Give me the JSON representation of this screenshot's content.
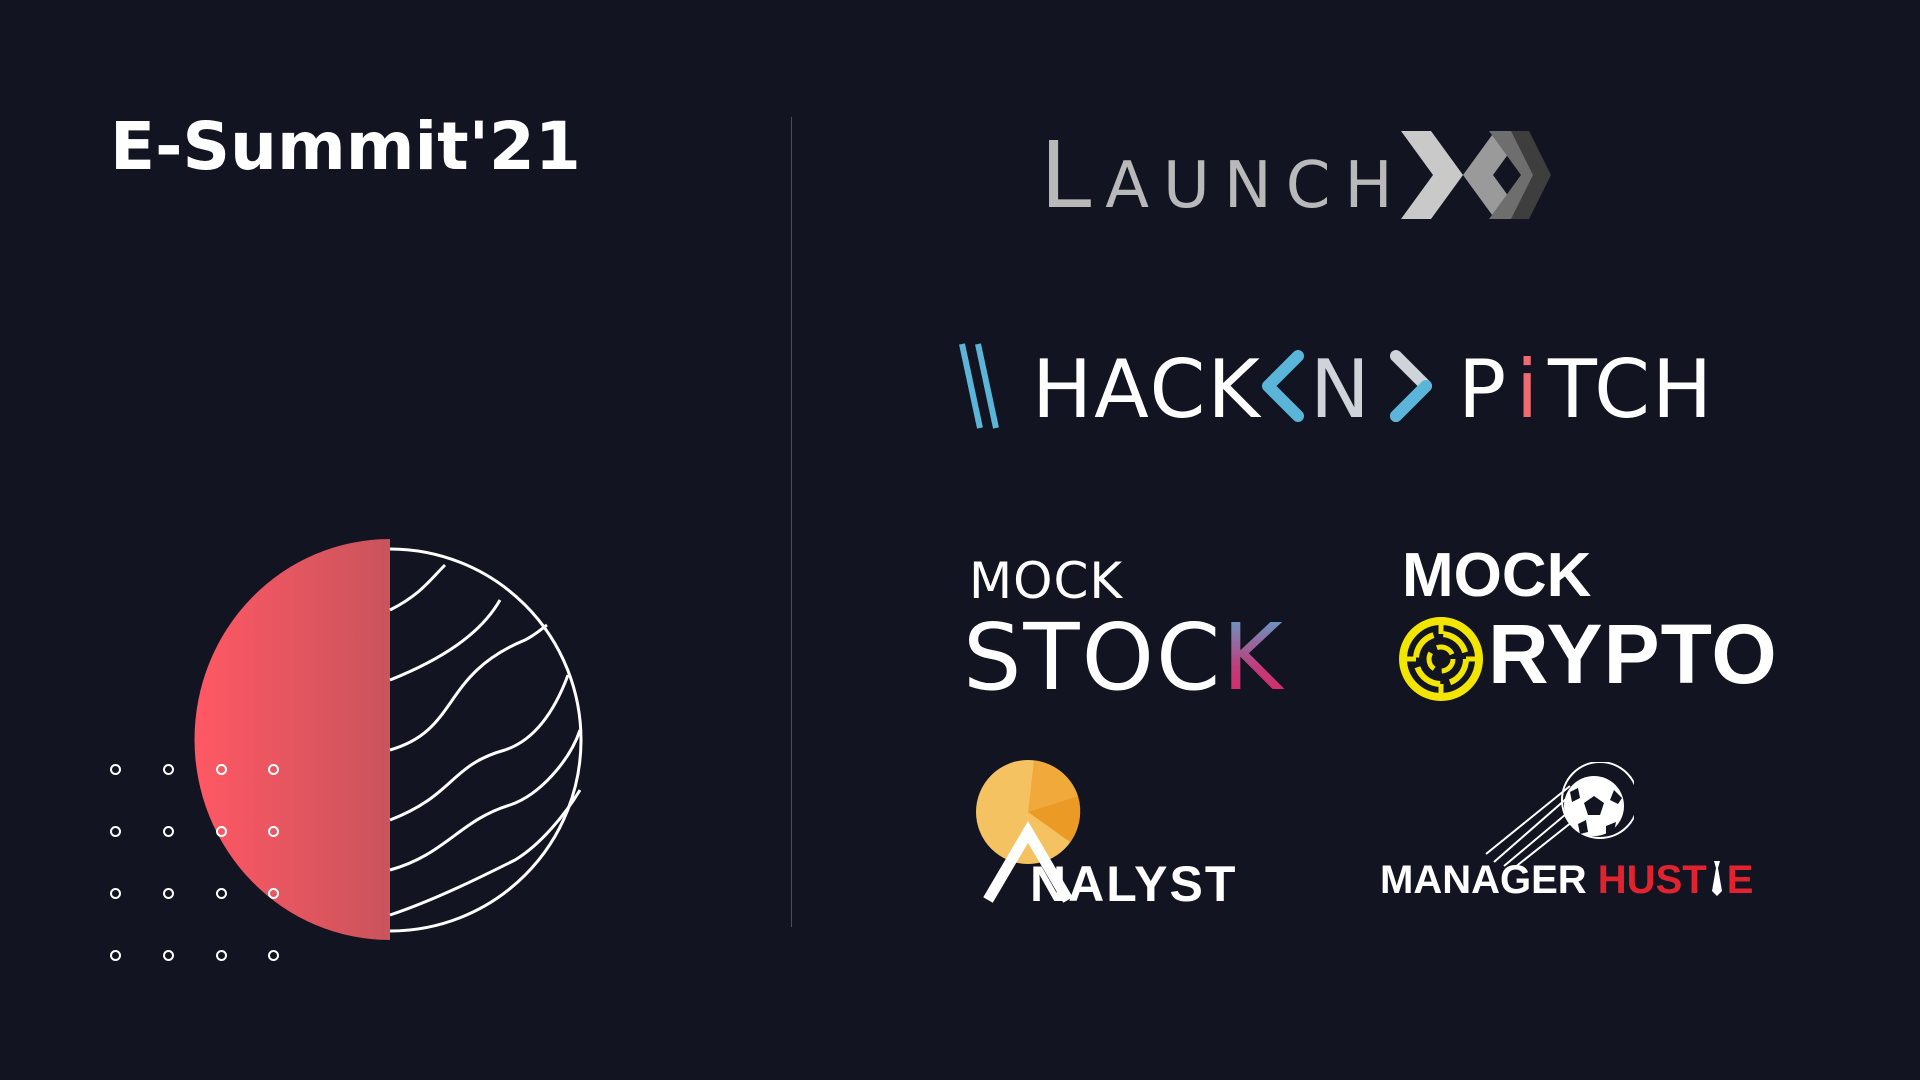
{
  "title": "E-Summit'21",
  "logos": {
    "launchx": {
      "text_main": "Launch",
      "text_x": "X"
    },
    "hacknpitch": {
      "word1": "HACK",
      "word2": "N",
      "word3_p": "P",
      "word3_i": "i",
      "word3_rest": "TCH"
    },
    "mockstock": {
      "line1": "MOCK",
      "line2_main": "STOC",
      "line2_accent": "K"
    },
    "mockcrypto": {
      "line1": "MOCK",
      "line2": "RYPTO"
    },
    "analyst": {
      "text": "NALYST"
    },
    "managerhustle": {
      "word1": "MANAGER",
      "word2": "HUST",
      "word2_end": "E"
    }
  },
  "colors": {
    "background": "#121521",
    "accent_red": "#f06a72",
    "hack_blue": "#5bb5d8",
    "analyst_orange": "#f2b34c",
    "crypto_yellow": "#f2e600",
    "hustle_red": "#e1232f"
  }
}
